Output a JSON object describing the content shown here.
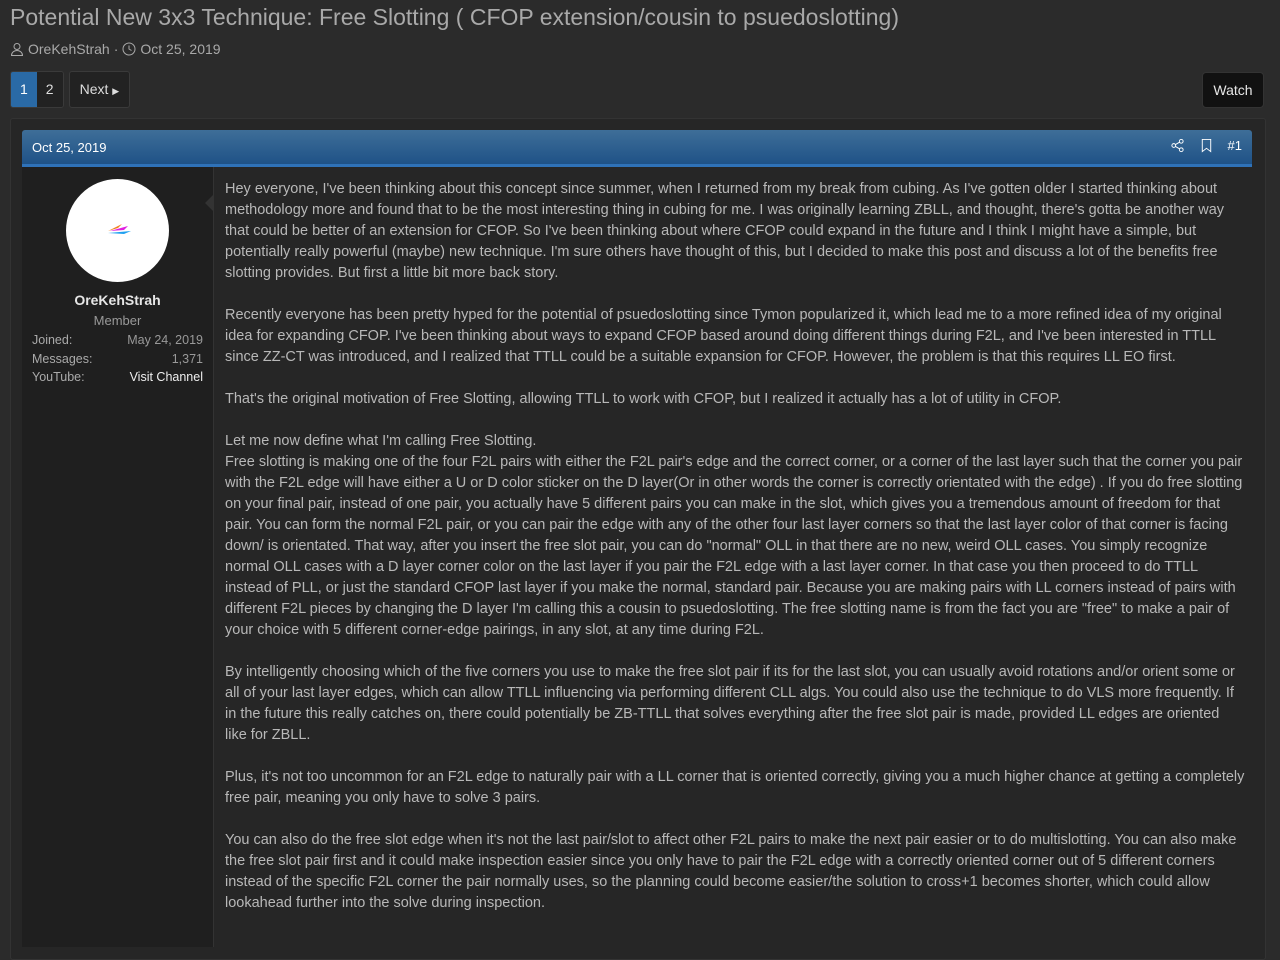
{
  "thread": {
    "title": "Potential New 3x3 Technique: Free Slotting ( CFOP extension/cousin to psuedoslotting)",
    "author": "OreKehStrah",
    "separator": "·",
    "date": "Oct 25, 2019"
  },
  "pagination": {
    "pages": [
      "1",
      "2"
    ],
    "current": "1",
    "next_label": "Next"
  },
  "watch_label": "Watch",
  "post": {
    "date": "Oct 25, 2019",
    "number": "#1",
    "icons": [
      "share-icon",
      "bookmark-icon"
    ],
    "user": {
      "name": "OreKehStrah",
      "role": "Member",
      "stats": [
        {
          "label": "Joined:",
          "value": "May 24, 2019"
        },
        {
          "label": "Messages:",
          "value": "1,371"
        },
        {
          "label": "YouTube:",
          "value": "Visit Channel"
        }
      ]
    },
    "paragraphs": [
      "Hey everyone, I've been thinking about this concept since summer, when I returned from my break from cubing. As I've gotten older I started thinking about methodology more and found that to be the most interesting thing in cubing for me. I was originally learning ZBLL, and thought, there's gotta be another way that could be better of an extension for CFOP. So I've been thinking about where CFOP could expand in the future and I think I might have a simple, but potentially really powerful (maybe) new technique. I'm sure others have thought of this, but I decided to make this post and discuss a lot of the benefits free slotting provides. But first a little bit more back story.",
      "Recently everyone has been pretty hyped for the potential of psuedoslotting since Tymon popularized it, which lead me to a more refined idea of my original idea for expanding CFOP. I've been thinking about ways to expand CFOP based around doing different things during F2L, and I've been interested in TTLL since ZZ-CT was introduced, and I realized that TTLL could be a suitable expansion for CFOP. However, the problem is that this requires LL EO first.",
      "That's the original motivation of Free Slotting, allowing TTLL to work with CFOP, but I realized it actually has a lot of utility in CFOP.",
      "Let me now define what I'm calling Free Slotting.\nFree slotting is making one of the four F2L pairs with either the F2L pair's edge and the correct corner, or a corner of the last layer such that the corner you pair with the F2L edge will have either a U or D color sticker on the D layer(Or in other words the corner is correctly orientated with the edge) . If you do free slotting on your final pair, instead of one pair, you actually have 5 different pairs you can make in the slot, which gives you a tremendous amount of freedom for that pair. You can form the normal F2L pair, or you can pair the edge with any of the other four last layer corners so that the last layer color of that corner is facing down/ is orientated. That way, after you insert the free slot pair, you can do \"normal\" OLL in that there are no new, weird OLL cases. You simply recognize normal OLL cases with a D layer corner color on the last layer if you pair the F2L edge with a last layer corner. In that case you then proceed to do TTLL instead of PLL, or just the standard CFOP last layer if you make the normal, standard pair. Because you are making pairs with LL corners instead of pairs with different F2L pieces by changing the D layer I'm calling this a cousin to psuedoslotting. The free slotting name is from the fact you are \"free\" to make a pair of your choice with 5 different corner-edge pairings, in any slot, at any time during F2L.",
      "By intelligently choosing which of the five corners you use to make the free slot pair if its for the last slot, you can usually avoid rotations and/or orient some or all of your last layer edges, which can allow TTLL influencing via performing different CLL algs. You could also use the technique to do VLS more frequently. If in the future this really catches on, there could potentially be ZB-TTLL that solves everything after the free slot pair is made, provided LL edges are oriented like for ZBLL.",
      "Plus, it's not too uncommon for an F2L edge to naturally pair with a LL corner that is oriented correctly, giving you a much higher chance at getting a completely free pair, meaning you only have to solve 3 pairs.",
      "You can also do the free slot edge when it's not the last pair/slot to affect other F2L pairs to make the next pair easier or to do multislotting. You can also make the free slot pair first and it could make inspection easier since you only have to pair the F2L edge with a correctly oriented corner out of 5 different corners instead of the specific F2L corner the pair normally uses, so the planning could become easier/the solution to cross+1 becomes shorter, which could allow lookahead further into the solve during inspection."
    ]
  },
  "colors": {
    "accent": "#2a6aa6",
    "header_top": "#3e6e98",
    "header_bottom": "#1f5287",
    "background": "#2b2b2b"
  }
}
